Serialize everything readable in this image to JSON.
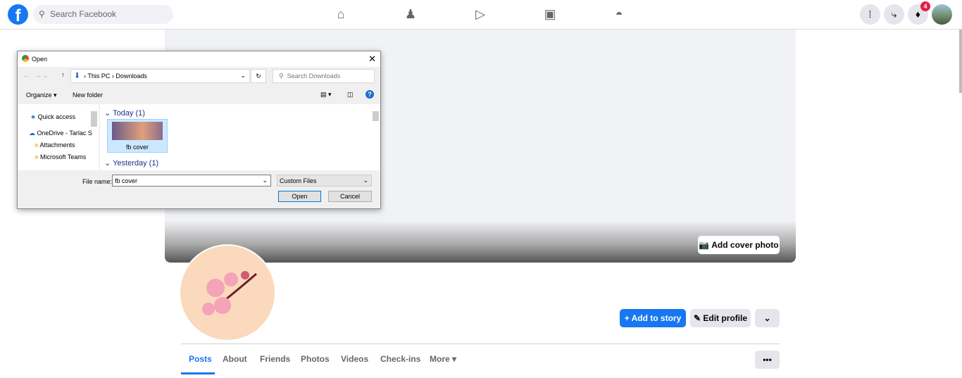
{
  "topbar": {
    "search_placeholder": "Search Facebook",
    "notification_count": "4",
    "brand_color": "#1877f2"
  },
  "cover": {
    "add_cover_label": "Add cover photo"
  },
  "profile": {
    "add_story": "Add to story",
    "edit_profile": "Edit profile"
  },
  "tabs": [
    "Posts",
    "About",
    "Friends",
    "Photos",
    "Videos",
    "Check-ins",
    "More"
  ],
  "dialog": {
    "title": "Open",
    "breadcrumb": [
      "This PC",
      "Downloads"
    ],
    "search_placeholder": "Search Downloads",
    "organize": "Organize",
    "new_folder": "New folder",
    "sidebar": [
      "Quick access",
      "OneDrive - Tarlac S",
      "Attachments",
      "Microsoft Teams"
    ],
    "groups": [
      "Today (1)",
      "Yesterday (1)"
    ],
    "file": "fb cover",
    "file_name_label": "File name:",
    "file_name_value": "fb cover",
    "file_type": "Custom Files",
    "open": "Open",
    "cancel": "Cancel"
  }
}
